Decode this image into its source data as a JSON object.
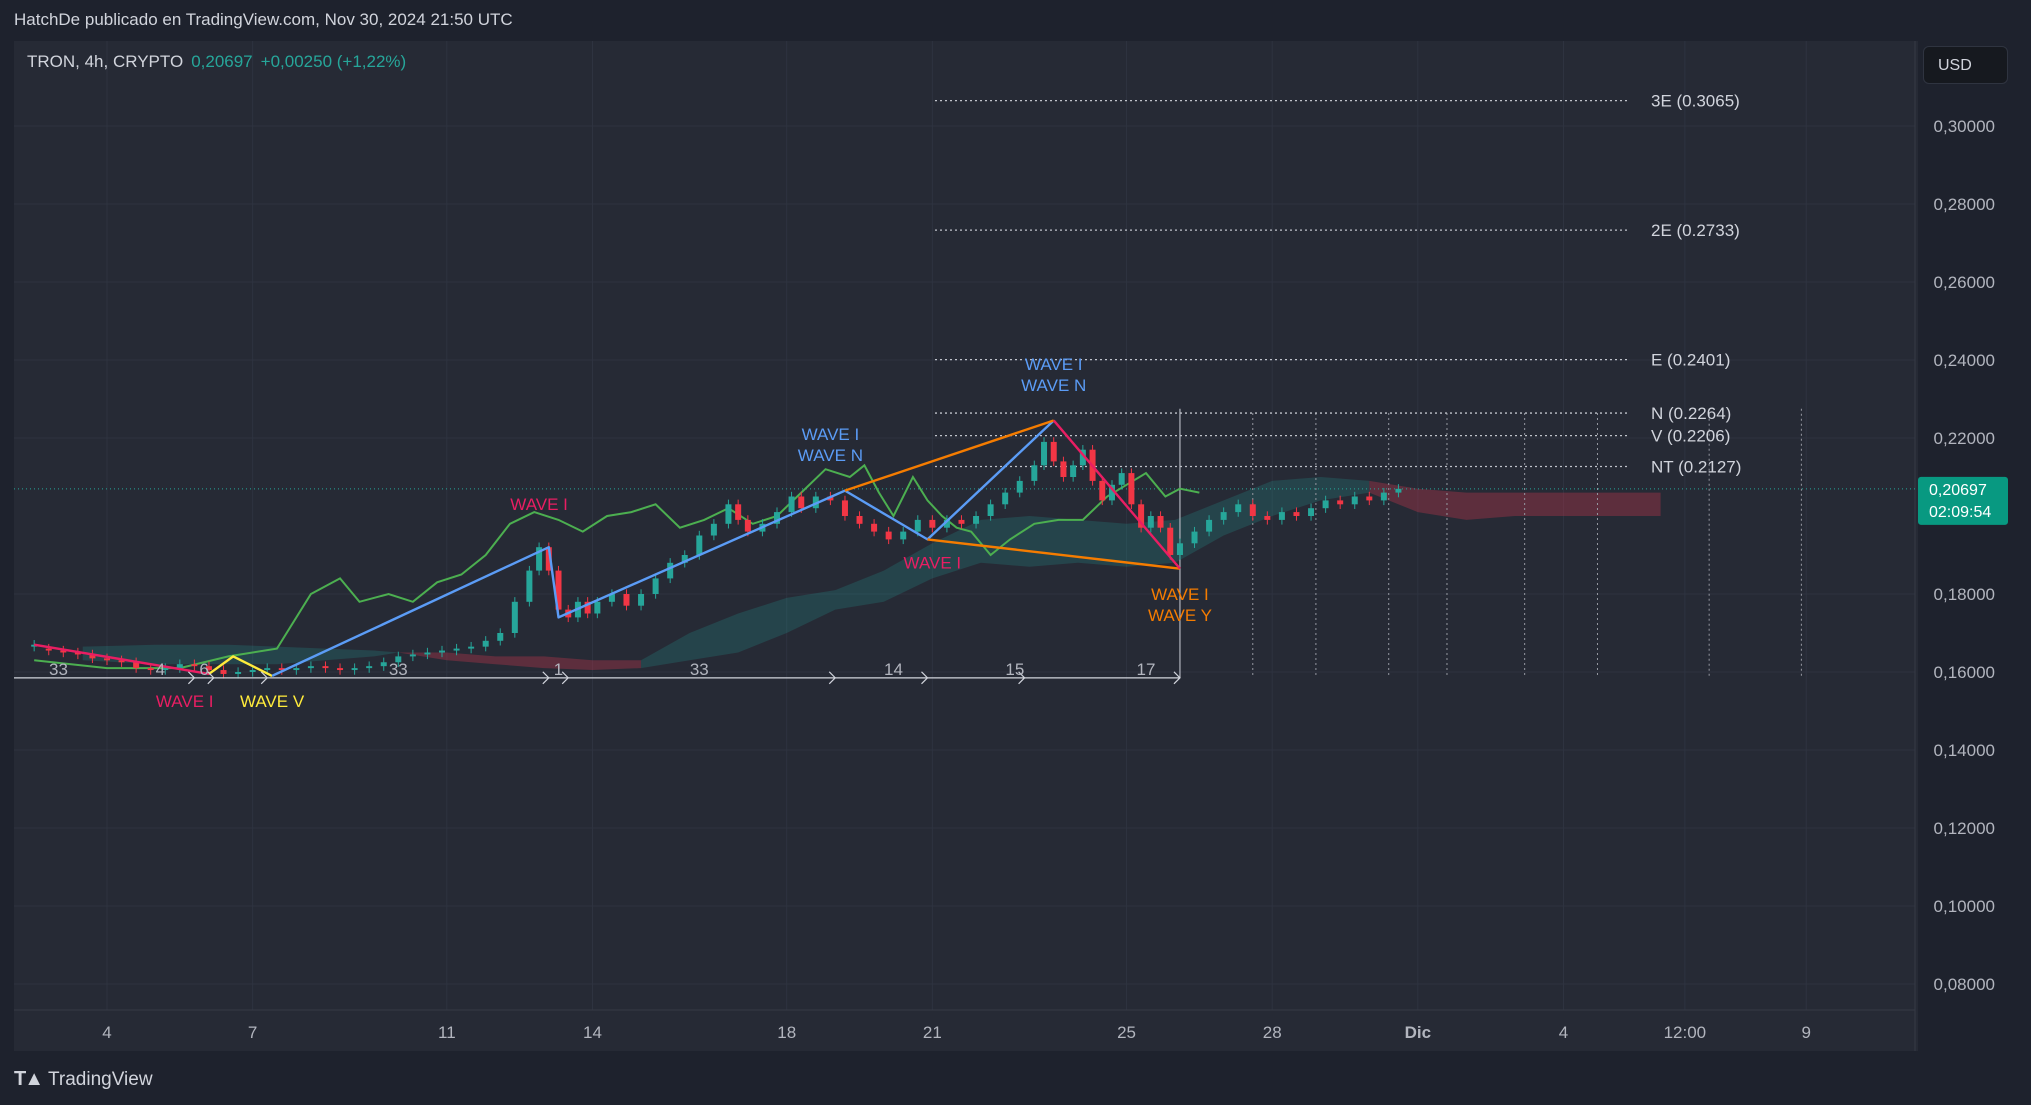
{
  "header": {
    "attribution": "HatchDe publicado en TradingView.com, Nov 30, 2024 21:50 UTC"
  },
  "legend": {
    "symbol": "TRON, 4h, CRYPTO",
    "price": "0,20697",
    "change": "+0,00250 (+1,22%)"
  },
  "currency_button": "USD",
  "footer": {
    "brand": "TradingView"
  },
  "price_badge": {
    "price": "0,20697",
    "countdown": "02:09:54",
    "color": "#089981"
  },
  "colors": {
    "blue": "#5b9cf6",
    "magenta": "#e91e63",
    "orange": "#f57c00",
    "yellow": "#ffeb3b",
    "green": "#4caf50",
    "cloud_green": "#26a69a",
    "cloud_red": "#b2344c",
    "up": "#26a69a",
    "down": "#f23645"
  },
  "chart_data": {
    "type": "candlestick",
    "ylim": [
      0.074,
      0.31
    ],
    "y_ticks": [
      {
        "v": 0.3,
        "label": "0,30000"
      },
      {
        "v": 0.28,
        "label": "0,28000"
      },
      {
        "v": 0.26,
        "label": "0,26000"
      },
      {
        "v": 0.24,
        "label": "0,24000"
      },
      {
        "v": 0.22,
        "label": "0,22000"
      },
      {
        "v": 0.18,
        "label": "0,18000"
      },
      {
        "v": 0.16,
        "label": "0,16000"
      },
      {
        "v": 0.14,
        "label": "0,14000"
      },
      {
        "v": 0.12,
        "label": "0,12000"
      },
      {
        "v": 0.1,
        "label": "0,10000"
      },
      {
        "v": 0.08,
        "label": "0,08000"
      }
    ],
    "x_ticks": [
      {
        "d": 4,
        "label": "4"
      },
      {
        "d": 7,
        "label": "7"
      },
      {
        "d": 11,
        "label": "11"
      },
      {
        "d": 14,
        "label": "14"
      },
      {
        "d": 18,
        "label": "18"
      },
      {
        "d": 21,
        "label": "21"
      },
      {
        "d": 25,
        "label": "25"
      },
      {
        "d": 28,
        "label": "28"
      },
      {
        "d": 31,
        "label": "Dic",
        "bold": true
      },
      {
        "d": 34,
        "label": "4"
      },
      {
        "d": 36.5,
        "label": "12:00"
      },
      {
        "d": 39,
        "label": "9"
      }
    ],
    "levels": [
      {
        "v": 0.3065,
        "label": "3E (0.3065)"
      },
      {
        "v": 0.2733,
        "label": "2E (0.2733)"
      },
      {
        "v": 0.2401,
        "label": "E (0.2401)"
      },
      {
        "v": 0.2264,
        "label": "N (0.2264)"
      },
      {
        "v": 0.2206,
        "label": "V (0.2206)"
      },
      {
        "v": 0.2127,
        "label": "NT (0.2127)"
      }
    ],
    "current_price": 0.20697,
    "candles": [
      [
        2.5,
        0.1665,
        0.167
      ],
      [
        2.8,
        0.166,
        0.1655
      ],
      [
        3.1,
        0.1655,
        0.165
      ],
      [
        3.4,
        0.165,
        0.1645
      ],
      [
        3.7,
        0.1645,
        0.1635
      ],
      [
        4.0,
        0.1635,
        0.163
      ],
      [
        4.3,
        0.163,
        0.1625
      ],
      [
        4.6,
        0.1625,
        0.161
      ],
      [
        4.9,
        0.161,
        0.1605
      ],
      [
        5.2,
        0.1605,
        0.161
      ],
      [
        5.5,
        0.161,
        0.162
      ],
      [
        5.8,
        0.162,
        0.1615
      ],
      [
        6.1,
        0.1615,
        0.1605
      ],
      [
        6.4,
        0.1605,
        0.1595
      ],
      [
        6.7,
        0.1595,
        0.16
      ],
      [
        7.0,
        0.16,
        0.1605
      ],
      [
        7.3,
        0.1605,
        0.161
      ],
      [
        7.6,
        0.161,
        0.1605
      ],
      [
        7.9,
        0.1605,
        0.161
      ],
      [
        8.2,
        0.161,
        0.1615
      ],
      [
        8.5,
        0.1615,
        0.161
      ],
      [
        8.8,
        0.161,
        0.1605
      ],
      [
        9.1,
        0.1605,
        0.161
      ],
      [
        9.4,
        0.161,
        0.1615
      ],
      [
        9.7,
        0.1615,
        0.1625
      ],
      [
        10.0,
        0.1625,
        0.164
      ],
      [
        10.3,
        0.164,
        0.1645
      ],
      [
        10.6,
        0.1645,
        0.165
      ],
      [
        10.9,
        0.165,
        0.1655
      ],
      [
        11.2,
        0.1655,
        0.166
      ],
      [
        11.5,
        0.166,
        0.1665
      ],
      [
        11.8,
        0.1665,
        0.168
      ],
      [
        12.1,
        0.168,
        0.17
      ],
      [
        12.4,
        0.17,
        0.178
      ],
      [
        12.7,
        0.178,
        0.186
      ],
      [
        12.9,
        0.186,
        0.192
      ],
      [
        13.1,
        0.192,
        0.186
      ],
      [
        13.3,
        0.186,
        0.176
      ],
      [
        13.5,
        0.176,
        0.174
      ],
      [
        13.7,
        0.174,
        0.178
      ],
      [
        13.9,
        0.178,
        0.175
      ],
      [
        14.1,
        0.175,
        0.178
      ],
      [
        14.4,
        0.178,
        0.18
      ],
      [
        14.7,
        0.18,
        0.177
      ],
      [
        15.0,
        0.177,
        0.18
      ],
      [
        15.3,
        0.18,
        0.184
      ],
      [
        15.6,
        0.184,
        0.188
      ],
      [
        15.9,
        0.188,
        0.19
      ],
      [
        16.2,
        0.19,
        0.195
      ],
      [
        16.5,
        0.195,
        0.198
      ],
      [
        16.8,
        0.198,
        0.203
      ],
      [
        17.0,
        0.203,
        0.199
      ],
      [
        17.2,
        0.199,
        0.196
      ],
      [
        17.5,
        0.196,
        0.198
      ],
      [
        17.8,
        0.198,
        0.201
      ],
      [
        18.1,
        0.201,
        0.205
      ],
      [
        18.3,
        0.205,
        0.202
      ],
      [
        18.6,
        0.202,
        0.205
      ],
      [
        18.9,
        0.205,
        0.204
      ],
      [
        19.2,
        0.204,
        0.2
      ],
      [
        19.5,
        0.2,
        0.198
      ],
      [
        19.8,
        0.198,
        0.196
      ],
      [
        20.1,
        0.196,
        0.194
      ],
      [
        20.4,
        0.194,
        0.196
      ],
      [
        20.7,
        0.196,
        0.199
      ],
      [
        21.0,
        0.199,
        0.197
      ],
      [
        21.3,
        0.197,
        0.199
      ],
      [
        21.6,
        0.199,
        0.198
      ],
      [
        21.9,
        0.198,
        0.2
      ],
      [
        22.2,
        0.2,
        0.203
      ],
      [
        22.5,
        0.203,
        0.206
      ],
      [
        22.8,
        0.206,
        0.209
      ],
      [
        23.1,
        0.209,
        0.213
      ],
      [
        23.3,
        0.213,
        0.219
      ],
      [
        23.5,
        0.219,
        0.214
      ],
      [
        23.7,
        0.214,
        0.21
      ],
      [
        23.9,
        0.21,
        0.213
      ],
      [
        24.1,
        0.213,
        0.217
      ],
      [
        24.3,
        0.217,
        0.209
      ],
      [
        24.5,
        0.209,
        0.204
      ],
      [
        24.7,
        0.204,
        0.208
      ],
      [
        24.9,
        0.208,
        0.211
      ],
      [
        25.1,
        0.211,
        0.203
      ],
      [
        25.3,
        0.203,
        0.197
      ],
      [
        25.5,
        0.197,
        0.2
      ],
      [
        25.7,
        0.2,
        0.197
      ],
      [
        25.9,
        0.197,
        0.19
      ],
      [
        26.1,
        0.19,
        0.193
      ],
      [
        26.4,
        0.193,
        0.196
      ],
      [
        26.7,
        0.196,
        0.199
      ],
      [
        27.0,
        0.199,
        0.201
      ],
      [
        27.3,
        0.201,
        0.203
      ],
      [
        27.6,
        0.203,
        0.2
      ],
      [
        27.9,
        0.2,
        0.199
      ],
      [
        28.2,
        0.199,
        0.201
      ],
      [
        28.5,
        0.201,
        0.2
      ],
      [
        28.8,
        0.2,
        0.202
      ],
      [
        29.1,
        0.202,
        0.204
      ],
      [
        29.4,
        0.204,
        0.203
      ],
      [
        29.7,
        0.203,
        0.205
      ],
      [
        30.0,
        0.205,
        0.204
      ],
      [
        30.3,
        0.204,
        0.206
      ],
      [
        30.6,
        0.206,
        0.20697
      ]
    ],
    "indicator_lines": [
      {
        "color": "green",
        "points": [
          [
            2.5,
            0.163
          ],
          [
            4,
            0.161
          ],
          [
            5.5,
            0.161
          ],
          [
            6.5,
            0.164
          ],
          [
            7.5,
            0.166
          ],
          [
            8.2,
            0.18
          ],
          [
            8.8,
            0.184
          ],
          [
            9.2,
            0.178
          ],
          [
            9.8,
            0.18
          ],
          [
            10.3,
            0.178
          ],
          [
            10.8,
            0.183
          ],
          [
            11.3,
            0.185
          ],
          [
            11.8,
            0.19
          ],
          [
            12.3,
            0.198
          ],
          [
            12.8,
            0.201
          ],
          [
            13.3,
            0.199
          ],
          [
            13.8,
            0.196
          ],
          [
            14.3,
            0.2
          ],
          [
            14.8,
            0.201
          ],
          [
            15.3,
            0.203
          ],
          [
            15.8,
            0.197
          ],
          [
            16.3,
            0.199
          ],
          [
            16.8,
            0.202
          ],
          [
            17.3,
            0.198
          ],
          [
            17.8,
            0.2
          ],
          [
            18.3,
            0.206
          ],
          [
            18.8,
            0.212
          ],
          [
            19.3,
            0.21
          ],
          [
            19.6,
            0.213
          ],
          [
            19.9,
            0.206
          ],
          [
            20.2,
            0.2
          ],
          [
            20.6,
            0.21
          ],
          [
            20.9,
            0.204
          ],
          [
            21.2,
            0.2
          ],
          [
            21.5,
            0.197
          ],
          [
            21.8,
            0.196
          ],
          [
            22.2,
            0.19
          ],
          [
            22.6,
            0.194
          ],
          [
            23.1,
            0.198
          ],
          [
            23.6,
            0.199
          ],
          [
            24.1,
            0.199
          ],
          [
            24.6,
            0.205
          ],
          [
            25.0,
            0.208
          ],
          [
            25.4,
            0.211
          ],
          [
            25.8,
            0.205
          ],
          [
            26.1,
            0.207
          ],
          [
            26.5,
            0.206
          ]
        ]
      }
    ],
    "cloud_segments": [
      {
        "color": "green",
        "top": [
          [
            3.5,
            0.1665
          ],
          [
            5,
            0.167
          ],
          [
            6.5,
            0.167
          ],
          [
            7.5,
            0.1665
          ],
          [
            8.5,
            0.166
          ],
          [
            9.5,
            0.1655
          ],
          [
            10,
            0.165
          ]
        ],
        "bottom": [
          [
            3.5,
            0.163
          ],
          [
            5,
            0.162
          ],
          [
            6.5,
            0.162
          ],
          [
            7.5,
            0.162
          ],
          [
            8.5,
            0.163
          ],
          [
            9.5,
            0.164
          ],
          [
            10,
            0.165
          ]
        ]
      },
      {
        "color": "red",
        "top": [
          [
            10,
            0.165
          ],
          [
            11,
            0.165
          ],
          [
            12,
            0.164
          ],
          [
            13,
            0.164
          ],
          [
            14,
            0.163
          ],
          [
            15,
            0.163
          ]
        ],
        "bottom": [
          [
            10,
            0.165
          ],
          [
            11,
            0.163
          ],
          [
            12,
            0.162
          ],
          [
            13,
            0.161
          ],
          [
            14,
            0.1605
          ],
          [
            15,
            0.161
          ]
        ]
      },
      {
        "color": "green",
        "top": [
          [
            15,
            0.163
          ],
          [
            16,
            0.17
          ],
          [
            17,
            0.175
          ],
          [
            18,
            0.179
          ],
          [
            19,
            0.181
          ],
          [
            20,
            0.186
          ],
          [
            21,
            0.193
          ],
          [
            22,
            0.199
          ],
          [
            23,
            0.2
          ],
          [
            24,
            0.199
          ],
          [
            25,
            0.198
          ],
          [
            26,
            0.199
          ],
          [
            27,
            0.204
          ],
          [
            28,
            0.209
          ],
          [
            29,
            0.21
          ],
          [
            30,
            0.209
          ]
        ],
        "bottom": [
          [
            15,
            0.161
          ],
          [
            16,
            0.163
          ],
          [
            17,
            0.165
          ],
          [
            18,
            0.17
          ],
          [
            19,
            0.176
          ],
          [
            20,
            0.178
          ],
          [
            21,
            0.184
          ],
          [
            22,
            0.188
          ],
          [
            23,
            0.187
          ],
          [
            24,
            0.188
          ],
          [
            25,
            0.187
          ],
          [
            26,
            0.188
          ],
          [
            27,
            0.195
          ],
          [
            28,
            0.2
          ],
          [
            29,
            0.204
          ],
          [
            30,
            0.206
          ]
        ]
      },
      {
        "color": "red",
        "top": [
          [
            30,
            0.209
          ],
          [
            31,
            0.207
          ],
          [
            32,
            0.206
          ],
          [
            33,
            0.206
          ],
          [
            34,
            0.206
          ],
          [
            35,
            0.206
          ],
          [
            36,
            0.206
          ]
        ],
        "bottom": [
          [
            30,
            0.206
          ],
          [
            31,
            0.201
          ],
          [
            32,
            0.199
          ],
          [
            33,
            0.2
          ],
          [
            34,
            0.2
          ],
          [
            35,
            0.2
          ],
          [
            36,
            0.2
          ]
        ]
      }
    ],
    "wave_lines": [
      {
        "color": "magenta",
        "points": [
          [
            2.5,
            0.167
          ],
          [
            6.1,
            0.1595
          ]
        ]
      },
      {
        "color": "yellow",
        "points": [
          [
            6.1,
            0.1595
          ],
          [
            6.6,
            0.164
          ],
          [
            7.4,
            0.159
          ]
        ]
      },
      {
        "color": "blue",
        "points": [
          [
            7.4,
            0.159
          ],
          [
            13.1,
            0.192
          ],
          [
            13.3,
            0.174
          ],
          [
            19.2,
            0.2065
          ],
          [
            20.9,
            0.194
          ],
          [
            23.5,
            0.2245
          ]
        ]
      },
      {
        "color": "orange",
        "points": [
          [
            19.2,
            0.2065
          ],
          [
            23.5,
            0.2245
          ]
        ]
      },
      {
        "color": "orange",
        "points": [
          [
            20.9,
            0.194
          ],
          [
            26.1,
            0.1865
          ]
        ]
      },
      {
        "color": "magenta",
        "points": [
          [
            23.5,
            0.2245
          ],
          [
            26.1,
            0.1865
          ]
        ]
      }
    ],
    "wave_labels": [
      {
        "x": 5.6,
        "y": 0.151,
        "lines": [
          "WAVE I"
        ],
        "color": "magenta"
      },
      {
        "x": 7.4,
        "y": 0.151,
        "lines": [
          "WAVE V"
        ],
        "color": "yellow"
      },
      {
        "x": 12.9,
        "y": 0.2015,
        "lines": [
          "WAVE I"
        ],
        "color": "magenta"
      },
      {
        "x": 18.9,
        "y": 0.2195,
        "lines": [
          "WAVE I",
          "WAVE N"
        ],
        "color": "blue"
      },
      {
        "x": 21.0,
        "y": 0.1865,
        "lines": [
          "WAVE I"
        ],
        "color": "magenta"
      },
      {
        "x": 23.5,
        "y": 0.2375,
        "lines": [
          "WAVE I",
          "WAVE N"
        ],
        "color": "blue"
      },
      {
        "x": 26.1,
        "y": 0.1785,
        "lines": [
          "WAVE I",
          "WAVE Y"
        ],
        "color": "orange"
      }
    ],
    "time_markers": [
      {
        "x": 3.0,
        "label": "33"
      },
      {
        "x": 5.1,
        "label": "4"
      },
      {
        "x": 6.0,
        "label": "6"
      },
      {
        "x": 10.0,
        "label": "33"
      },
      {
        "x": 13.3,
        "label": "1"
      },
      {
        "x": 16.2,
        "label": "33"
      },
      {
        "x": 20.2,
        "label": "14"
      },
      {
        "x": 22.7,
        "label": "15"
      },
      {
        "x": 25.4,
        "label": "17"
      }
    ],
    "forecast_days": [
      26.1,
      27.6,
      28.9,
      30.4,
      31.6,
      33.2,
      34.7,
      37.0,
      38.9
    ]
  }
}
